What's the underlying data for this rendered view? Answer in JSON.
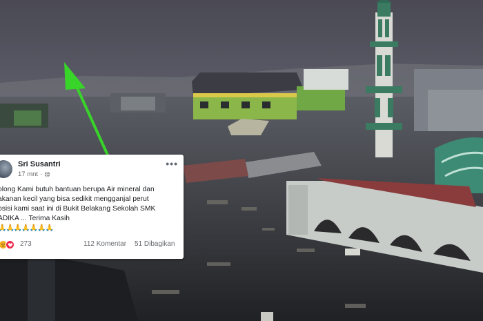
{
  "post": {
    "author": "Sri Susantri",
    "time": "17 mnt",
    "menu_glyph": "•••",
    "text": "olong Kami butuh bantuan berupa Air mineral dan\nakanan kecil yang bisa sedikit mengganjal perut\nosisi kami saat ini di Bukit Belakang Sekolah SMK\nADIKA ... Terima Kasih",
    "emoji_row": "🙏🙏🙏🙏🙏🙏🙏",
    "reaction_count": "273",
    "comments": "112 Komentar",
    "shares": "51 Dibagikan"
  },
  "icons": {
    "globe": "globe-icon",
    "sad": "sad-reaction-icon",
    "love": "love-reaction-icon",
    "arrow": "green-arrow-annotation"
  },
  "colors": {
    "arrow": "#39d42a",
    "love": "#f0284a",
    "sad": "#f7b125"
  }
}
